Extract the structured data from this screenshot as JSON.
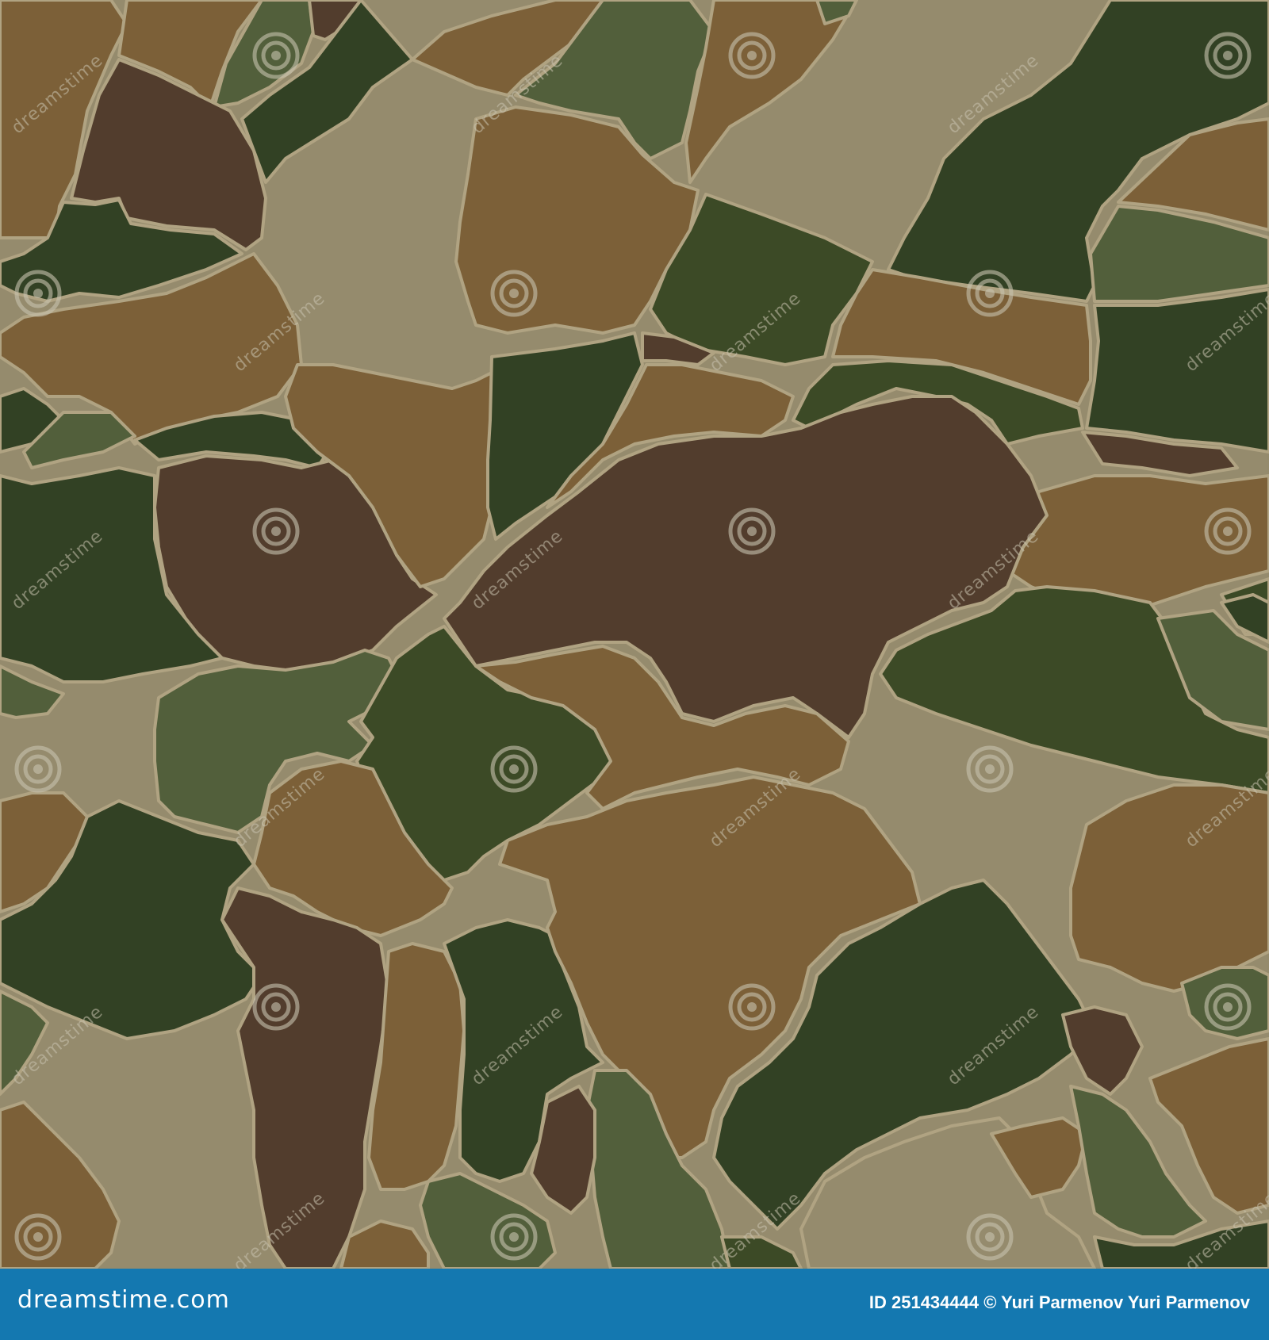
{
  "image": {
    "kind": "seamless camouflage pattern",
    "palette": {
      "dark_green": "#324124",
      "olive_green": "#3c4a26",
      "moss_green": "#525f3b",
      "ochre_brown": "#7c6038",
      "dark_brown": "#523d2d",
      "khaki": "#958b6d",
      "outline": "#b0a382"
    }
  },
  "watermark": {
    "text": "dreamstime",
    "icon": "spiral-logo-icon"
  },
  "footer": {
    "background_color": "#1478b0",
    "logo_text": "dreamstime.com",
    "credit_text": "ID 251434444 © Yuri Parmenov  Yuri Parmenov"
  }
}
